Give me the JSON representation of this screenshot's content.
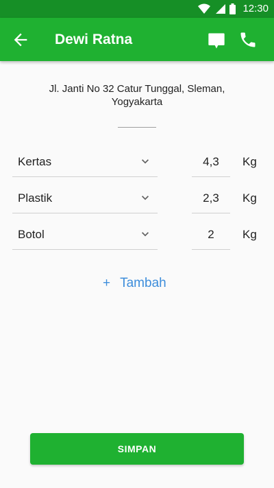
{
  "status_bar": {
    "time": "12:30"
  },
  "app_bar": {
    "title": "Dewi Ratna"
  },
  "address": "Jl. Janti No 32 Catur Tunggal, Sleman, Yogyakarta",
  "items": [
    {
      "type": "Kertas",
      "quantity": "4,3",
      "unit": "Kg"
    },
    {
      "type": "Plastik",
      "quantity": "2,3",
      "unit": "Kg"
    },
    {
      "type": "Botol",
      "quantity": "2",
      "unit": "Kg"
    }
  ],
  "add_button": {
    "plus": "+",
    "label": "Tambah"
  },
  "save_button": {
    "label": "SIMPAN"
  },
  "colors": {
    "primary": "#1fb131",
    "primary_dark": "#168f26",
    "accent": "#3d8ddb"
  }
}
